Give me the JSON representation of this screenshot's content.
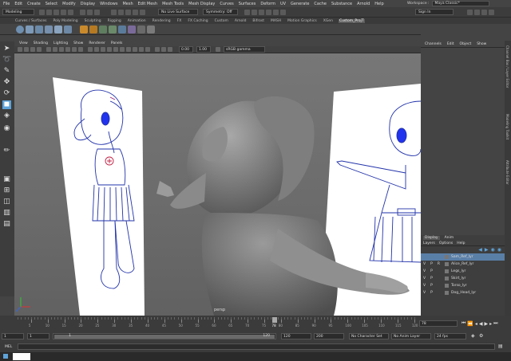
{
  "menu": [
    "File",
    "Edit",
    "Create",
    "Select",
    "Modify",
    "Display",
    "Windows",
    "Mesh",
    "Edit Mesh",
    "Mesh Tools",
    "Mesh Display",
    "Curves",
    "Surfaces",
    "Deform",
    "UV",
    "Generate",
    "Cache",
    "Substance",
    "Arnold",
    "Help"
  ],
  "workspace": {
    "label": "Workspace :",
    "value": "Maya Classic*"
  },
  "status_line": {
    "mode": "Modeling",
    "live_surface": "No Live Surface",
    "symmetry": "Symmetry: Off",
    "sign_in": "Sign In"
  },
  "shelf_tabs": [
    "Curves / Surfaces",
    "Poly Modeling",
    "Sculpting",
    "Rigging",
    "Animation",
    "Rendering",
    "FX",
    "FX Caching",
    "Custom",
    "Arnold",
    "Bifrost",
    "MASH",
    "Motion Graphics",
    "XGen",
    "Custom_ProjT"
  ],
  "shelf_active": "Custom_ProjT",
  "panel_menu": [
    "View",
    "Shading",
    "Lighting",
    "Show",
    "Renderer",
    "Panels"
  ],
  "viewport": {
    "near_value": "0.00",
    "far_value": "1.00",
    "color_space": "sRGB gamma",
    "camera_label": "persp"
  },
  "channel_box": {
    "tabs": [
      "Channels",
      "Edit",
      "Object",
      "Show"
    ]
  },
  "side_tabs": [
    "Channel Box / Layer Editor",
    "Modeling Toolkit",
    "Attribute Editor"
  ],
  "layer_editor": {
    "tabs": [
      "Display",
      "Anim"
    ],
    "menu": [
      "Layers",
      "Options",
      "Help"
    ],
    "layers": [
      {
        "v": "",
        "p": "",
        "r": "",
        "name": "Sam_Ref_lyr",
        "selected": true
      },
      {
        "v": "V",
        "p": "P",
        "r": "R",
        "name": "Alice_Ref_lyr",
        "selected": false
      },
      {
        "v": "V",
        "p": "P",
        "r": "",
        "name": "Legs_lyr",
        "selected": false
      },
      {
        "v": "V",
        "p": "P",
        "r": "",
        "name": "Skirt_lyr",
        "selected": false
      },
      {
        "v": "V",
        "p": "P",
        "r": "",
        "name": "Torso_lyr",
        "selected": false
      },
      {
        "v": "V",
        "p": "P",
        "r": "",
        "name": "Dog_Head_lyr",
        "selected": false
      }
    ]
  },
  "timeline": {
    "ticks": [
      "5",
      "10",
      "15",
      "20",
      "25",
      "30",
      "35",
      "40",
      "45",
      "50",
      "55",
      "60",
      "65",
      "70",
      "75",
      "80",
      "85",
      "90",
      "95",
      "100",
      "105",
      "110",
      "115",
      "120"
    ],
    "current_frame": "78",
    "current_frame_field": "78"
  },
  "range": {
    "start": "1",
    "playback_start": "1",
    "playback_current": "1",
    "playback_end": "120",
    "end": "120",
    "anim_end": "200",
    "character_set": "No Character Set",
    "anim_layer": "No Anim Layer",
    "fps": "24 fps"
  },
  "command_line": {
    "lang": "MEL"
  },
  "colors": {
    "accent": "#5ea3d9",
    "sketch_line": "#2233aa",
    "model_gray": "#8c8c8c",
    "layer_selected": "#5a7fa7"
  }
}
